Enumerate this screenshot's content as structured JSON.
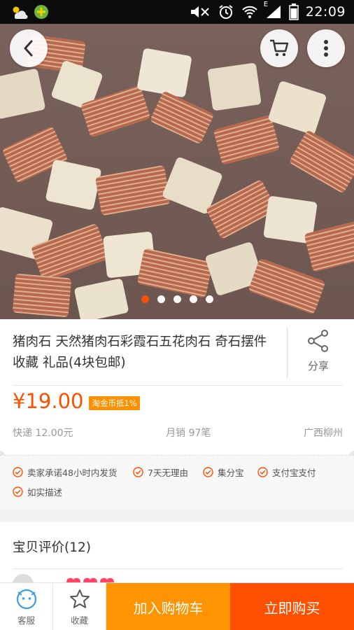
{
  "status_bar": {
    "time": "22:09",
    "network_type": "E",
    "icons": [
      "weather-icon",
      "app-notification-icon",
      "mute-icon",
      "alarm-icon",
      "wifi-icon",
      "signal-icon",
      "battery-icon"
    ]
  },
  "hero": {
    "icons": {
      "back": "chevron-left-icon",
      "cart": "cart-icon",
      "more": "more-vertical-icon"
    },
    "carousel": {
      "count": 5,
      "active_index": 0
    }
  },
  "product": {
    "title": "猪肉石 天然猪肉石彩霞石五花肉石 奇石摆件 收藏 礼品(4块包邮)",
    "share_label": "分享",
    "price": "¥19.00",
    "badge": "淘金币抵1%",
    "shipping": "快递 12.00元",
    "monthly_sales": "月销 97笔",
    "location": "广西柳州",
    "promises": [
      "卖家承诺48小时内发货",
      "7天无理由",
      "集分宝",
      "支付宝支付",
      "如实描述"
    ]
  },
  "reviews": {
    "title": "宝贝评价(12)"
  },
  "bottom_bar": {
    "service_label": "客服",
    "favorite_label": "收藏",
    "add_to_cart_label": "加入购物车",
    "buy_now_label": "立即购买"
  },
  "colors": {
    "accent": "#ff5000",
    "cart_button": "#ff9402",
    "badge": "#ff9000",
    "service_icon": "#3aa0e0"
  }
}
